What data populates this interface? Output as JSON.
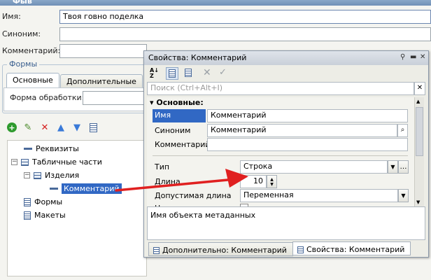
{
  "window": {
    "title": "Фыв"
  },
  "form": {
    "name_label": "Имя:",
    "name_value": "Твоя говно поделка",
    "synonym_label": "Синоним:",
    "synonym_value": "",
    "comment_label": "Комментарий:",
    "comment_value": ""
  },
  "forms_group": {
    "title": "Формы",
    "tabs": [
      "Основные",
      "Дополнительные"
    ],
    "processing_form_label": "Форма обработки:",
    "processing_form_value": ""
  },
  "toolbar": {
    "icons": [
      "add-icon",
      "edit-icon",
      "delete-icon",
      "move-up-icon",
      "move-down-icon",
      "list-icon"
    ]
  },
  "tree": {
    "items": [
      {
        "label": "Реквизиты",
        "icon": "attribute-icon"
      },
      {
        "label": "Табличные части",
        "icon": "table-icon"
      },
      {
        "label": "Изделия",
        "icon": "table-icon"
      },
      {
        "label": "Комментарий",
        "icon": "attribute-icon"
      },
      {
        "label": "Формы",
        "icon": "form-icon"
      },
      {
        "label": "Макеты",
        "icon": "template-icon"
      }
    ]
  },
  "properties": {
    "title": "Свойства: Комментарий",
    "search_placeholder": "Поиск (Ctrl+Alt+I)",
    "section": "Основные:",
    "name_label": "Имя",
    "name_value": "Комментарий",
    "synonym_label": "Синоним",
    "synonym_value": "Комментарий",
    "comment_label": "Комментарий",
    "comment_value": "",
    "type_label": "Тип",
    "type_value": "Строка",
    "length_label": "Длина",
    "length_value": "10",
    "allowed_length_label": "Допустимая длина",
    "allowed_length_value": "Переменная",
    "next_label_partial": "Н",
    "description": "Имя объекта метаданных",
    "bottom_tabs": [
      "Дополнительно: Комментарий",
      "Свойства: Комментарий"
    ]
  },
  "colors": {
    "arrow": "#e02020",
    "selection": "#3168c4",
    "title_bar": "#7895bd"
  }
}
